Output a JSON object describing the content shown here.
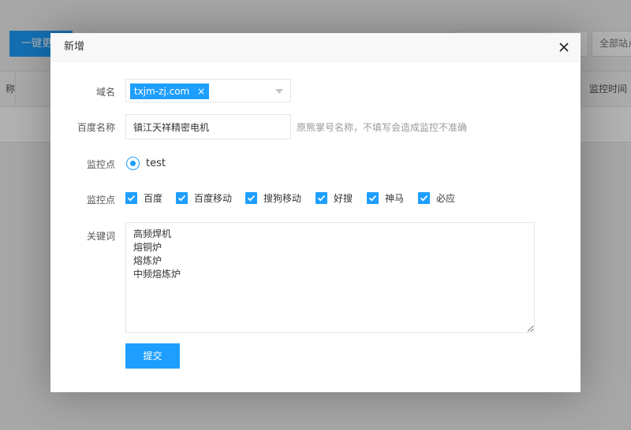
{
  "background": {
    "primary_button": "一键更新",
    "all_sites_button": "全部站点",
    "col_left_fragment": "称",
    "col_monitor_time": "监控时间"
  },
  "modal": {
    "title": "新增",
    "domain": {
      "label": "域名",
      "selected_tag": "txjm-zj.com",
      "tag_close": "×"
    },
    "baidu_name": {
      "label": "百度名称",
      "value": "镇江天祥精密电机",
      "hint": "原熊掌号名称，不填写会造成监控不准确"
    },
    "monitor_node": {
      "label": "监控点",
      "option": "test"
    },
    "monitor_engines": {
      "label": "监控点",
      "items": [
        {
          "label": "百度"
        },
        {
          "label": "百度移动"
        },
        {
          "label": "搜狗移动"
        },
        {
          "label": "好搜"
        },
        {
          "label": "神马"
        },
        {
          "label": "必应"
        }
      ]
    },
    "keywords": {
      "label": "关键词",
      "value": "高频焊机\n熔铜炉\n熔炼炉\n中频熔炼炉"
    },
    "submit_label": "提交"
  },
  "colors": {
    "accent": "#1e9fff",
    "hint": "#999999"
  }
}
